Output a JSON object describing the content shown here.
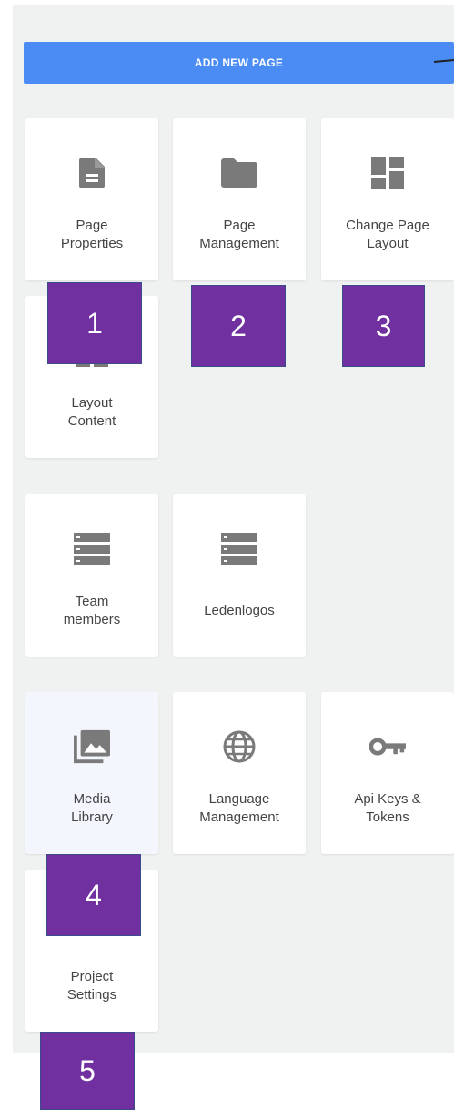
{
  "toolbar": {
    "add_label": "ADD NEW PAGE"
  },
  "cards": {
    "page_properties": {
      "label": "Page\nProperties",
      "icon": "document-icon"
    },
    "page_management": {
      "label": "Page\nManagement",
      "icon": "folder-icon"
    },
    "change_layout": {
      "label": "Change Page\nLayout",
      "icon": "dashboard-icon"
    },
    "layout_content": {
      "label": "Layout\nContent",
      "icon": "view-icon"
    },
    "team_members": {
      "label": "Team\nmembers",
      "icon": "list-icon"
    },
    "ledenlogos": {
      "label": "Ledenlogos",
      "icon": "list-icon"
    },
    "media_library": {
      "label": "Media\nLibrary",
      "icon": "photo-library-icon"
    },
    "language_management": {
      "label": "Language\nManagement",
      "icon": "globe-icon"
    },
    "api_keys": {
      "label": "Api Keys &\nTokens",
      "icon": "key-icon"
    },
    "project_settings": {
      "label": "Project\nSettings",
      "icon": "settings-icon"
    }
  },
  "badges": [
    "1",
    "2",
    "3",
    "4",
    "5"
  ],
  "colors": {
    "accent": "#4a8cf4",
    "badge": "#7030a0",
    "icon": "#7a7a7a"
  }
}
